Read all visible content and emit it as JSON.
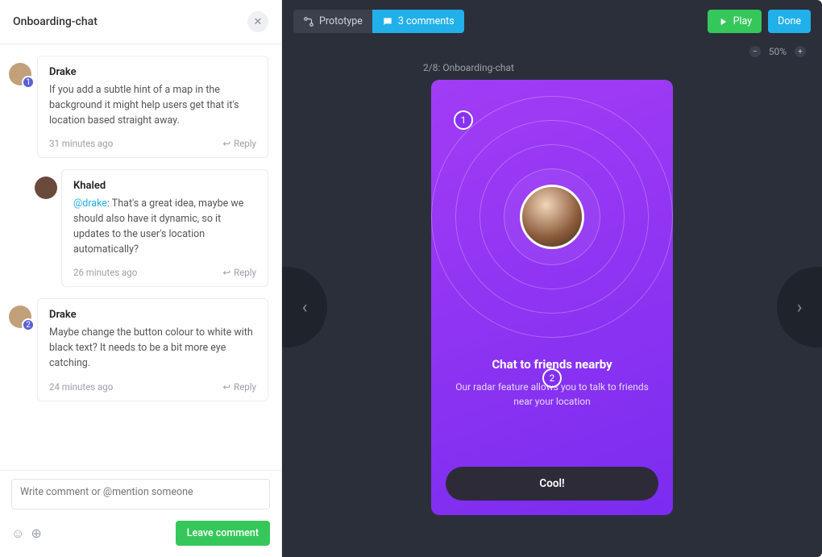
{
  "panel": {
    "title": "Onboarding-chat"
  },
  "comments": [
    {
      "author": "Drake",
      "badge": "1",
      "body_plain": "If you add a subtle hint of a map in the background it might help users get that it's location based straight away.",
      "time": "31 minutes ago",
      "reply_label": "Reply"
    },
    {
      "author": "Khaled",
      "mention": "@drake",
      "body_plain": ": That's a great idea, maybe we should also have it dynamic, so it updates to the user's location automatically?",
      "time": "26 minutes ago",
      "reply_label": "Reply"
    },
    {
      "author": "Drake",
      "badge": "2",
      "body_plain": "Maybe change the button colour to white with black text? It needs to be a bit more eye catching.",
      "time": "24 minutes ago",
      "reply_label": "Reply"
    }
  ],
  "composer": {
    "placeholder": "Write comment or @mention someone",
    "submit": "Leave comment"
  },
  "toolbar": {
    "prototype": "Prototype",
    "comments": "3 comments",
    "play": "Play",
    "done": "Done"
  },
  "zoom": {
    "value": "50%"
  },
  "canvas": {
    "breadcrumb": "2/8: Onboarding-chat"
  },
  "device": {
    "marker1": "1",
    "marker2": "2",
    "title": "Chat to friends nearby",
    "subtitle": "Our radar feature allows you to talk to friends near your location",
    "button": "Cool!"
  }
}
